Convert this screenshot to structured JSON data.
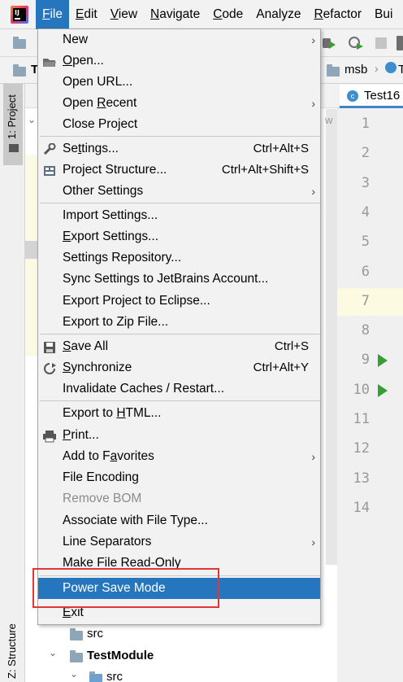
{
  "menubar": {
    "items": [
      {
        "label": "File",
        "mnemonic": "F",
        "rest": "ile",
        "active": true
      },
      {
        "label": "Edit",
        "mnemonic": "E",
        "rest": "dit"
      },
      {
        "label": "View",
        "mnemonic": "V",
        "rest": "iew"
      },
      {
        "label": "Navigate",
        "mnemonic": "N",
        "rest": "avigate"
      },
      {
        "label": "Code",
        "mnemonic": "C",
        "rest": "ode"
      },
      {
        "label": "Analyze",
        "mnemonic": "",
        "rest": "Analyze"
      },
      {
        "label": "Refactor",
        "mnemonic": "R",
        "rest": "efactor"
      },
      {
        "label": "Bui",
        "mnemonic": "",
        "rest": "Bui"
      }
    ]
  },
  "navbar": {
    "crumb_left": "T",
    "crumb_msb": "msb",
    "crumb_right": "T"
  },
  "left_strip": {
    "project_tab": "1: Project",
    "structure_tab": "Z: Structure"
  },
  "editor": {
    "tab_label": "Test16",
    "fragment": "w",
    "line_numbers": [
      "1",
      "2",
      "3",
      "4",
      "5",
      "6",
      "7",
      "8",
      "9",
      "10",
      "11",
      "12",
      "13",
      "14"
    ],
    "run_lines": [
      9,
      10
    ],
    "highlight_line": 7
  },
  "file_menu": {
    "items": [
      {
        "id": "new",
        "pre": "",
        "mn": "",
        "post": "New",
        "submenu": true
      },
      {
        "id": "open",
        "pre": "",
        "mn": "O",
        "post": "pen...",
        "icon": "folder-open-icon"
      },
      {
        "id": "open_url",
        "pre": "Open URL...",
        "mn": "",
        "post": ""
      },
      {
        "id": "open_recent",
        "pre": "Open ",
        "mn": "R",
        "post": "ecent",
        "submenu": true
      },
      {
        "id": "close_project",
        "pre": "Close Project",
        "mn": "",
        "post": ""
      },
      {
        "id": "settings",
        "pre": "Se",
        "mn": "t",
        "post": "tings...",
        "shortcut": "Ctrl+Alt+S",
        "icon": "wrench-icon"
      },
      {
        "id": "project_structure",
        "pre": "Project Structure...",
        "mn": "",
        "post": "",
        "shortcut": "Ctrl+Alt+Shift+S",
        "icon": "project-structure-icon"
      },
      {
        "id": "other_settings",
        "pre": "Other Settings",
        "mn": "",
        "post": "",
        "submenu": true
      },
      {
        "id": "import_settings",
        "pre": "Import Settings...",
        "mn": "",
        "post": ""
      },
      {
        "id": "export_settings",
        "pre": "",
        "mn": "E",
        "post": "xport Settings..."
      },
      {
        "id": "settings_repository",
        "pre": "Settings Repository...",
        "mn": "",
        "post": ""
      },
      {
        "id": "sync_settings",
        "pre": "Sync Settings to JetBrains Account...",
        "mn": "",
        "post": ""
      },
      {
        "id": "export_eclipse",
        "pre": "Export Project to Eclipse...",
        "mn": "",
        "post": ""
      },
      {
        "id": "export_zip",
        "pre": "Export to Zip File...",
        "mn": "",
        "post": ""
      },
      {
        "id": "save_all",
        "pre": "",
        "mn": "S",
        "post": "ave All",
        "shortcut": "Ctrl+S",
        "icon": "save-icon"
      },
      {
        "id": "synchronize",
        "pre": "",
        "mn": "S",
        "post": "ynchronize",
        "shortcut": "Ctrl+Alt+Y",
        "icon": "sync-icon"
      },
      {
        "id": "invalidate_caches",
        "pre": "Invalidate Caches / Restart...",
        "mn": "",
        "post": ""
      },
      {
        "id": "export_html",
        "pre": "Export to ",
        "mn": "H",
        "post": "TML..."
      },
      {
        "id": "print",
        "pre": "",
        "mn": "P",
        "post": "rint...",
        "icon": "printer-icon"
      },
      {
        "id": "add_favorites",
        "pre": "Add to F",
        "mn": "a",
        "post": "vorites",
        "submenu": true
      },
      {
        "id": "file_encoding",
        "pre": "File Encoding",
        "mn": "",
        "post": ""
      },
      {
        "id": "remove_bom",
        "pre": "Remove BOM",
        "mn": "",
        "post": "",
        "disabled": true
      },
      {
        "id": "associate_file_type",
        "pre": "Associate with File Type...",
        "mn": "",
        "post": ""
      },
      {
        "id": "line_separators",
        "pre": "Line Separators",
        "mn": "",
        "post": "",
        "submenu": true
      },
      {
        "id": "make_read_only",
        "pre": "Make File Read-Only",
        "mn": "",
        "post": ""
      },
      {
        "id": "power_save_mode",
        "pre": "Power Save Mode",
        "mn": "",
        "post": "",
        "selected": true
      },
      {
        "id": "exit",
        "pre": "",
        "mn": "E",
        "post": "xit"
      }
    ]
  },
  "project_tree": {
    "src_1": "src",
    "module": "TestModule",
    "src_2": "src"
  },
  "colors": {
    "accent": "#2675bf",
    "highlight_box": "#e13636",
    "run_green": "#389e33"
  }
}
